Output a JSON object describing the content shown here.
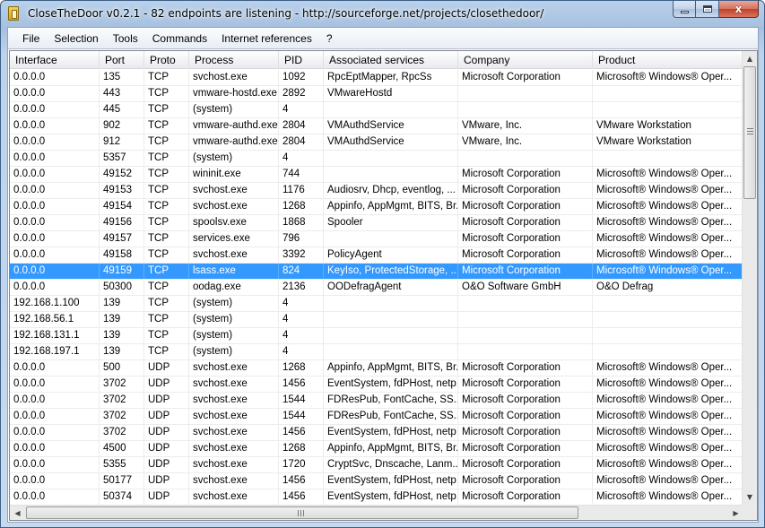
{
  "window": {
    "title": "CloseTheDoor v0.2.1 - 82 endpoints are listening - http://sourceforge.net/projects/closethedoor/",
    "minimize_glyph": "",
    "maximize_glyph": "",
    "close_glyph": "x"
  },
  "menu": [
    {
      "label": "File"
    },
    {
      "label": "Selection"
    },
    {
      "label": "Tools"
    },
    {
      "label": "Commands"
    },
    {
      "label": "Internet references"
    },
    {
      "label": "?"
    }
  ],
  "table": {
    "columns": [
      "Interface",
      "Port",
      "Proto",
      "Process",
      "PID",
      "Associated services",
      "Company",
      "Product"
    ],
    "selected_row": 12,
    "rows": [
      [
        "0.0.0.0",
        "135",
        "TCP",
        "svchost.exe",
        "1092",
        "RpcEptMapper, RpcSs",
        "Microsoft Corporation",
        "Microsoft® Windows® Oper..."
      ],
      [
        "0.0.0.0",
        "443",
        "TCP",
        "vmware-hostd.exe",
        "2892",
        "VMwareHostd",
        "",
        ""
      ],
      [
        "0.0.0.0",
        "445",
        "TCP",
        "(system)",
        "4",
        "",
        "",
        ""
      ],
      [
        "0.0.0.0",
        "902",
        "TCP",
        "vmware-authd.exe",
        "2804",
        "VMAuthdService",
        "VMware, Inc.",
        "VMware Workstation"
      ],
      [
        "0.0.0.0",
        "912",
        "TCP",
        "vmware-authd.exe",
        "2804",
        "VMAuthdService",
        "VMware, Inc.",
        "VMware Workstation"
      ],
      [
        "0.0.0.0",
        "5357",
        "TCP",
        "(system)",
        "4",
        "",
        "",
        ""
      ],
      [
        "0.0.0.0",
        "49152",
        "TCP",
        "wininit.exe",
        "744",
        "",
        "Microsoft Corporation",
        "Microsoft® Windows® Oper..."
      ],
      [
        "0.0.0.0",
        "49153",
        "TCP",
        "svchost.exe",
        "1176",
        "Audiosrv, Dhcp, eventlog, ...",
        "Microsoft Corporation",
        "Microsoft® Windows® Oper..."
      ],
      [
        "0.0.0.0",
        "49154",
        "TCP",
        "svchost.exe",
        "1268",
        "Appinfo, AppMgmt, BITS, Br...",
        "Microsoft Corporation",
        "Microsoft® Windows® Oper..."
      ],
      [
        "0.0.0.0",
        "49156",
        "TCP",
        "spoolsv.exe",
        "1868",
        "Spooler",
        "Microsoft Corporation",
        "Microsoft® Windows® Oper..."
      ],
      [
        "0.0.0.0",
        "49157",
        "TCP",
        "services.exe",
        "796",
        "",
        "Microsoft Corporation",
        "Microsoft® Windows® Oper..."
      ],
      [
        "0.0.0.0",
        "49158",
        "TCP",
        "svchost.exe",
        "3392",
        "PolicyAgent",
        "Microsoft Corporation",
        "Microsoft® Windows® Oper..."
      ],
      [
        "0.0.0.0",
        "49159",
        "TCP",
        "lsass.exe",
        "824",
        "KeyIso, ProtectedStorage, ...",
        "Microsoft Corporation",
        "Microsoft® Windows® Oper..."
      ],
      [
        "0.0.0.0",
        "50300",
        "TCP",
        "oodag.exe",
        "2136",
        "OODefragAgent",
        "O&O Software GmbH",
        "O&O Defrag"
      ],
      [
        "192.168.1.100",
        "139",
        "TCP",
        "(system)",
        "4",
        "",
        "",
        ""
      ],
      [
        "192.168.56.1",
        "139",
        "TCP",
        "(system)",
        "4",
        "",
        "",
        ""
      ],
      [
        "192.168.131.1",
        "139",
        "TCP",
        "(system)",
        "4",
        "",
        "",
        ""
      ],
      [
        "192.168.197.1",
        "139",
        "TCP",
        "(system)",
        "4",
        "",
        "",
        ""
      ],
      [
        "0.0.0.0",
        "500",
        "UDP",
        "svchost.exe",
        "1268",
        "Appinfo, AppMgmt, BITS, Br...",
        "Microsoft Corporation",
        "Microsoft® Windows® Oper..."
      ],
      [
        "0.0.0.0",
        "3702",
        "UDP",
        "svchost.exe",
        "1456",
        "EventSystem, fdPHost, netp...",
        "Microsoft Corporation",
        "Microsoft® Windows® Oper..."
      ],
      [
        "0.0.0.0",
        "3702",
        "UDP",
        "svchost.exe",
        "1544",
        "FDResPub, FontCache, SS...",
        "Microsoft Corporation",
        "Microsoft® Windows® Oper..."
      ],
      [
        "0.0.0.0",
        "3702",
        "UDP",
        "svchost.exe",
        "1544",
        "FDResPub, FontCache, SS...",
        "Microsoft Corporation",
        "Microsoft® Windows® Oper..."
      ],
      [
        "0.0.0.0",
        "3702",
        "UDP",
        "svchost.exe",
        "1456",
        "EventSystem, fdPHost, netp...",
        "Microsoft Corporation",
        "Microsoft® Windows® Oper..."
      ],
      [
        "0.0.0.0",
        "4500",
        "UDP",
        "svchost.exe",
        "1268",
        "Appinfo, AppMgmt, BITS, Br...",
        "Microsoft Corporation",
        "Microsoft® Windows® Oper..."
      ],
      [
        "0.0.0.0",
        "5355",
        "UDP",
        "svchost.exe",
        "1720",
        "CryptSvc, Dnscache, Lanm...",
        "Microsoft Corporation",
        "Microsoft® Windows® Oper..."
      ],
      [
        "0.0.0.0",
        "50177",
        "UDP",
        "svchost.exe",
        "1456",
        "EventSystem, fdPHost, netp...",
        "Microsoft Corporation",
        "Microsoft® Windows® Oper..."
      ],
      [
        "0.0.0.0",
        "50374",
        "UDP",
        "svchost.exe",
        "1456",
        "EventSystem, fdPHost, netp...",
        "Microsoft Corporation",
        "Microsoft® Windows® Oper..."
      ]
    ]
  },
  "scrollbars": {
    "up_arrow": "▲",
    "down_arrow": "▼",
    "left_arrow": "◀",
    "right_arrow": "▶"
  },
  "colors": {
    "selection": "#3399ff"
  }
}
